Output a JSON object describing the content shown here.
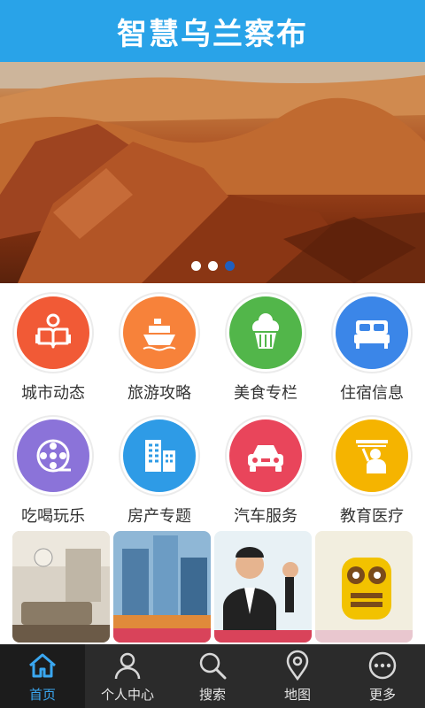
{
  "header": {
    "title": "智慧乌兰察布"
  },
  "banner": {
    "slide_count": 3,
    "active_slide": 3
  },
  "grid": {
    "items": [
      {
        "label": "城市动态",
        "color": "#f15a36",
        "icon": "book-reader-icon"
      },
      {
        "label": "旅游攻略",
        "color": "#f7823a",
        "icon": "ship-icon"
      },
      {
        "label": "美食专栏",
        "color": "#52b64a",
        "icon": "cupcake-icon"
      },
      {
        "label": "住宿信息",
        "color": "#3b86e8",
        "icon": "bed-icon"
      },
      {
        "label": "吃喝玩乐",
        "color": "#8b73d9",
        "icon": "film-reel-icon"
      },
      {
        "label": "房产专题",
        "color": "#2e9be6",
        "icon": "buildings-icon"
      },
      {
        "label": "汽车服务",
        "color": "#e9455b",
        "icon": "car-icon"
      },
      {
        "label": "教育医疗",
        "color": "#f5b400",
        "icon": "teacher-icon"
      }
    ]
  },
  "tabbar": {
    "items": [
      {
        "label": "首页",
        "icon": "home-icon",
        "active": true
      },
      {
        "label": "个人中心",
        "icon": "person-icon",
        "active": false
      },
      {
        "label": "搜索",
        "icon": "search-icon",
        "active": false
      },
      {
        "label": "地图",
        "icon": "map-pin-icon",
        "active": false
      },
      {
        "label": "更多",
        "icon": "more-icon",
        "active": false
      }
    ]
  }
}
